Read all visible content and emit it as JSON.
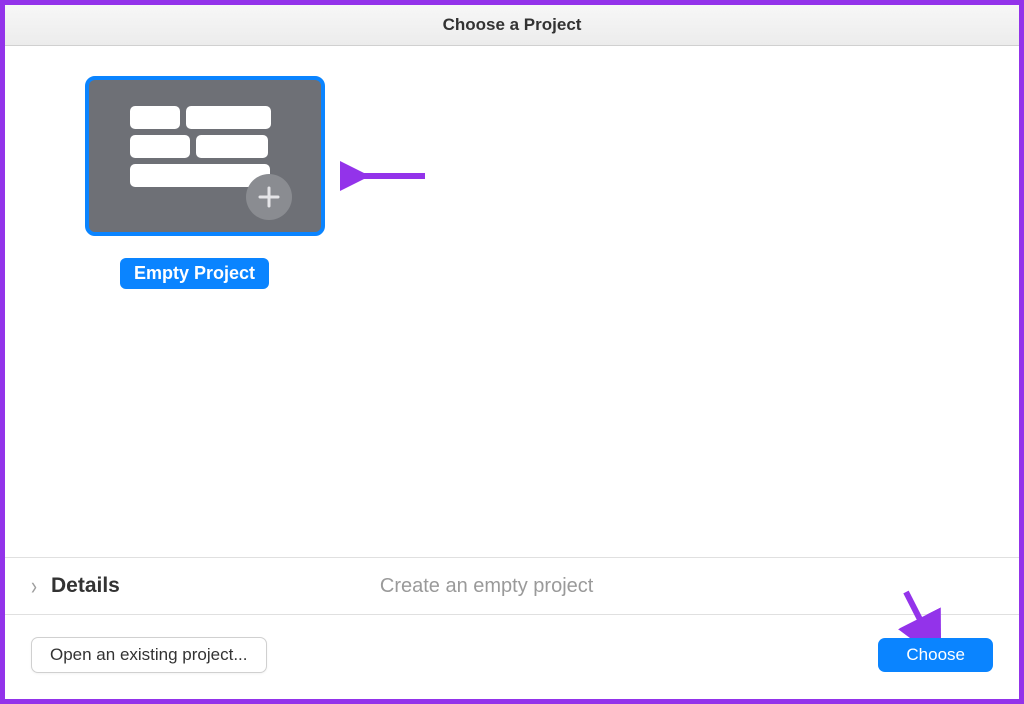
{
  "header": {
    "title": "Choose a Project"
  },
  "projects": {
    "empty": {
      "label": "Empty Project",
      "plus_icon": "plus-icon"
    }
  },
  "details": {
    "label": "Details",
    "description": "Create an empty project",
    "chevron_icon": "chevron-right-icon"
  },
  "footer": {
    "open_existing_label": "Open an existing project...",
    "choose_label": "Choose"
  },
  "colors": {
    "accent": "#0a84ff",
    "annotation": "#9333ea"
  }
}
